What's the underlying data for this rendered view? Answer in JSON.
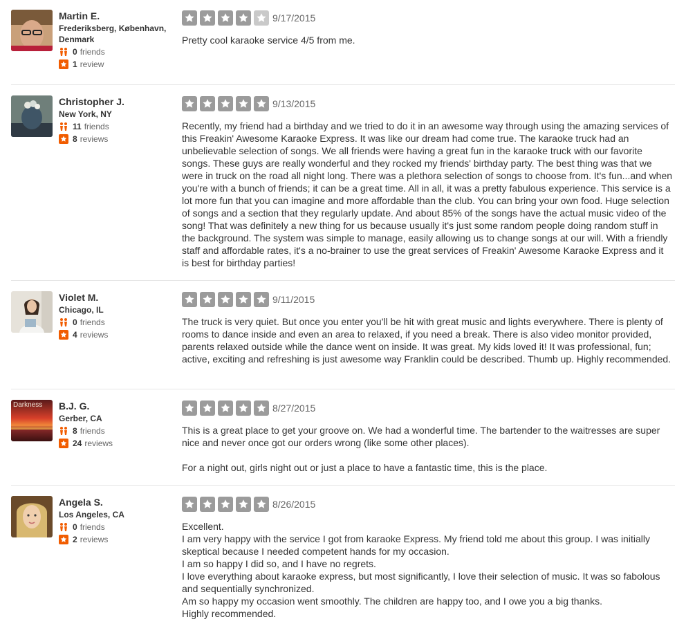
{
  "reviews": [
    {
      "name": "Martin E.",
      "location": "Frederiksberg, København, Denmark",
      "friends_count": "0",
      "friends_label": "friends",
      "reviews_count": "1",
      "reviews_label": "review",
      "rating": 4,
      "date": "9/17/2015",
      "paragraphs": [
        "Pretty cool karaoke service 4/5 from me."
      ]
    },
    {
      "name": "Christopher J.",
      "location": "New York, NY",
      "friends_count": "11",
      "friends_label": "friends",
      "reviews_count": "8",
      "reviews_label": "reviews",
      "rating": 5,
      "date": "9/13/2015",
      "paragraphs": [
        "Recently, my friend had a birthday and we tried to do it in an awesome way through using the amazing services of this Freakin' Awesome Karaoke Express. It was like our dream had come true. The karaoke truck had an unbelievable selection of songs. We all friends were having a great fun in the karaoke truck with our favorite songs. These guys are really wonderful and they rocked my friends' birthday party. The best thing was that we were in truck on the road all night long. There was a plethora selection of songs to choose from. It's fun...and when you're with a bunch of friends; it can be a great time. All in all, it was a pretty fabulous experience. This service is a lot more fun that you can imagine and more affordable than the club. You can bring your own food. Huge selection of songs and a section that they regularly update. And about 85% of the songs have the actual music video of the song! That was definitely a new thing for us because usually it's just some random people doing random stuff in the background. The system was simple to manage, easily allowing us to change songs at our will. With a friendly staff and affordable rates, it's a no-brainer to use the great services of Freakin' Awesome Karaoke Express and it is best for birthday parties!"
      ]
    },
    {
      "name": "Violet M.",
      "location": "Chicago, IL",
      "friends_count": "0",
      "friends_label": "friends",
      "reviews_count": "4",
      "reviews_label": "reviews",
      "rating": 5,
      "date": "9/11/2015",
      "paragraphs": [
        "The truck is very quiet. But once you enter you'll be hit with great music and lights everywhere. There is plenty of rooms to dance inside and even an area to relaxed, if you need a break. There is also video monitor provided, parents relaxed outside while the dance went on inside. It was great. My kids loved it! It was professional, fun; active, exciting and refreshing is just awesome way Franklin could be described. Thumb up. Highly recommended."
      ]
    },
    {
      "name": "B.J. G.",
      "location": "Gerber, CA",
      "friends_count": "8",
      "friends_label": "friends",
      "reviews_count": "24",
      "reviews_label": "reviews",
      "rating": 5,
      "date": "8/27/2015",
      "avatar_text": "Darkness",
      "paragraphs": [
        "This is a great place to get your groove on. We had a wonderful time. The bartender to the waitresses are super nice and never once got our orders wrong (like some other places).",
        "For a night out, girls night out or just a place to have a fantastic time, this is the place."
      ]
    },
    {
      "name": "Angela S.",
      "location": "Los Angeles, CA",
      "friends_count": "0",
      "friends_label": "friends",
      "reviews_count": "2",
      "reviews_label": "reviews",
      "rating": 5,
      "date": "8/26/2015",
      "paragraphs": [
        "Excellent.",
        "I am very happy with the service I got from karaoke Express. My friend told me about this group. I was initially skeptical because I needed competent hands for my occasion.",
        "I am so happy I did so, and I have no regrets.",
        "I love everything about karaoke express, but most significantly, I love their selection of music. It was so fabolous and sequentially synchronized.",
        "Am so happy my occasion went smoothly.  The children are happy too, and I owe you a big thanks.",
        "Highly recommended."
      ]
    }
  ],
  "icons": {
    "friends": "friends-icon",
    "reviews": "review-star-icon",
    "rating_star": "rating-star-icon"
  },
  "colors": {
    "star_filled": "#9b9b9b",
    "star_empty": "#c9c9c9",
    "stat_accent": "#f15c00"
  }
}
